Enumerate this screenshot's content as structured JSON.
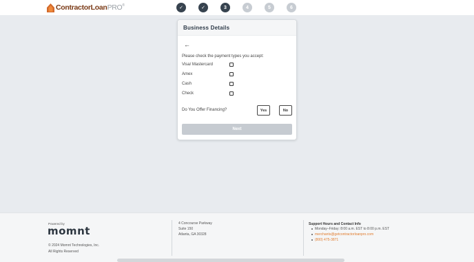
{
  "header": {
    "logo_main": "ContractorLoan",
    "logo_suffix": "PRO",
    "logo_tm": "®",
    "steps": [
      {
        "label": "✓",
        "state": "done"
      },
      {
        "label": "✓",
        "state": "done"
      },
      {
        "label": "3",
        "state": "current"
      },
      {
        "label": "4",
        "state": "todo"
      },
      {
        "label": "5",
        "state": "todo"
      },
      {
        "label": "6",
        "state": "todo"
      }
    ]
  },
  "card": {
    "title": "Business Details",
    "back_icon": "arrow-left-icon",
    "prompt": "Please check the payment types you accept:",
    "payment_types": [
      {
        "label": "Visa/ Mastercard",
        "checked": false
      },
      {
        "label": "Amex",
        "checked": false
      },
      {
        "label": "Cash",
        "checked": false
      },
      {
        "label": "Check",
        "checked": false
      }
    ],
    "financing_question": "Do You Offer Financing?",
    "yes_label": "Yes",
    "no_label": "No",
    "next_label": "Next"
  },
  "footer": {
    "powered_by": "Powered by",
    "brand": "momnt",
    "copyright": "© 2024 Momnt Technologies, Inc.",
    "rights": "All Rights Reserved",
    "address_line1": "4 Concourse Parkway",
    "address_line2": "Suite 150",
    "address_line3": "Atlanta, GA 30328",
    "support_title": "Support Hours and Contact Info",
    "hours": "Monday–Friday: 8:00 a.m. EST to 8:00 p.m. EST",
    "email": "merchants@getcontractorloanpro.com",
    "phone": "(800) 475-3871"
  },
  "colors": {
    "accent": "#e07b2c",
    "step_active": "#37434f",
    "step_inactive": "#c7ccd2",
    "next_disabled": "#c6cbd1"
  }
}
